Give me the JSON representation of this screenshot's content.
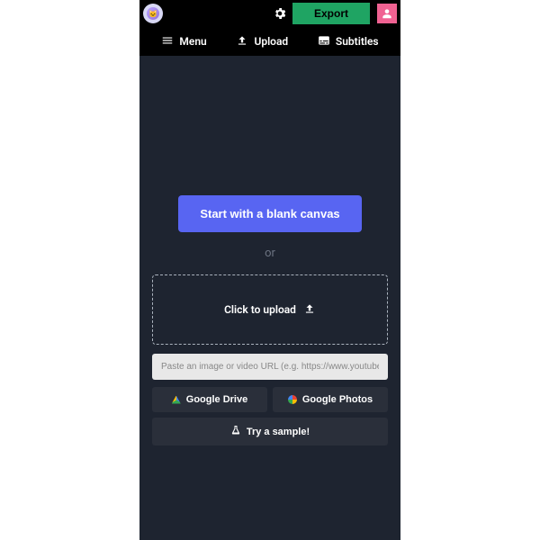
{
  "topbar": {
    "export_label": "Export"
  },
  "nav": {
    "menu_label": "Menu",
    "upload_label": "Upload",
    "subtitles_label": "Subtitles"
  },
  "main": {
    "blank_canvas_label": "Start with a blank canvas",
    "or_label": "or",
    "click_upload_label": "Click to upload",
    "url_placeholder": "Paste an image or video URL (e.g. https://www.youtube.com",
    "gdrive_label": "Google Drive",
    "gphotos_label": "Google Photos",
    "sample_label": "Try a sample!"
  }
}
